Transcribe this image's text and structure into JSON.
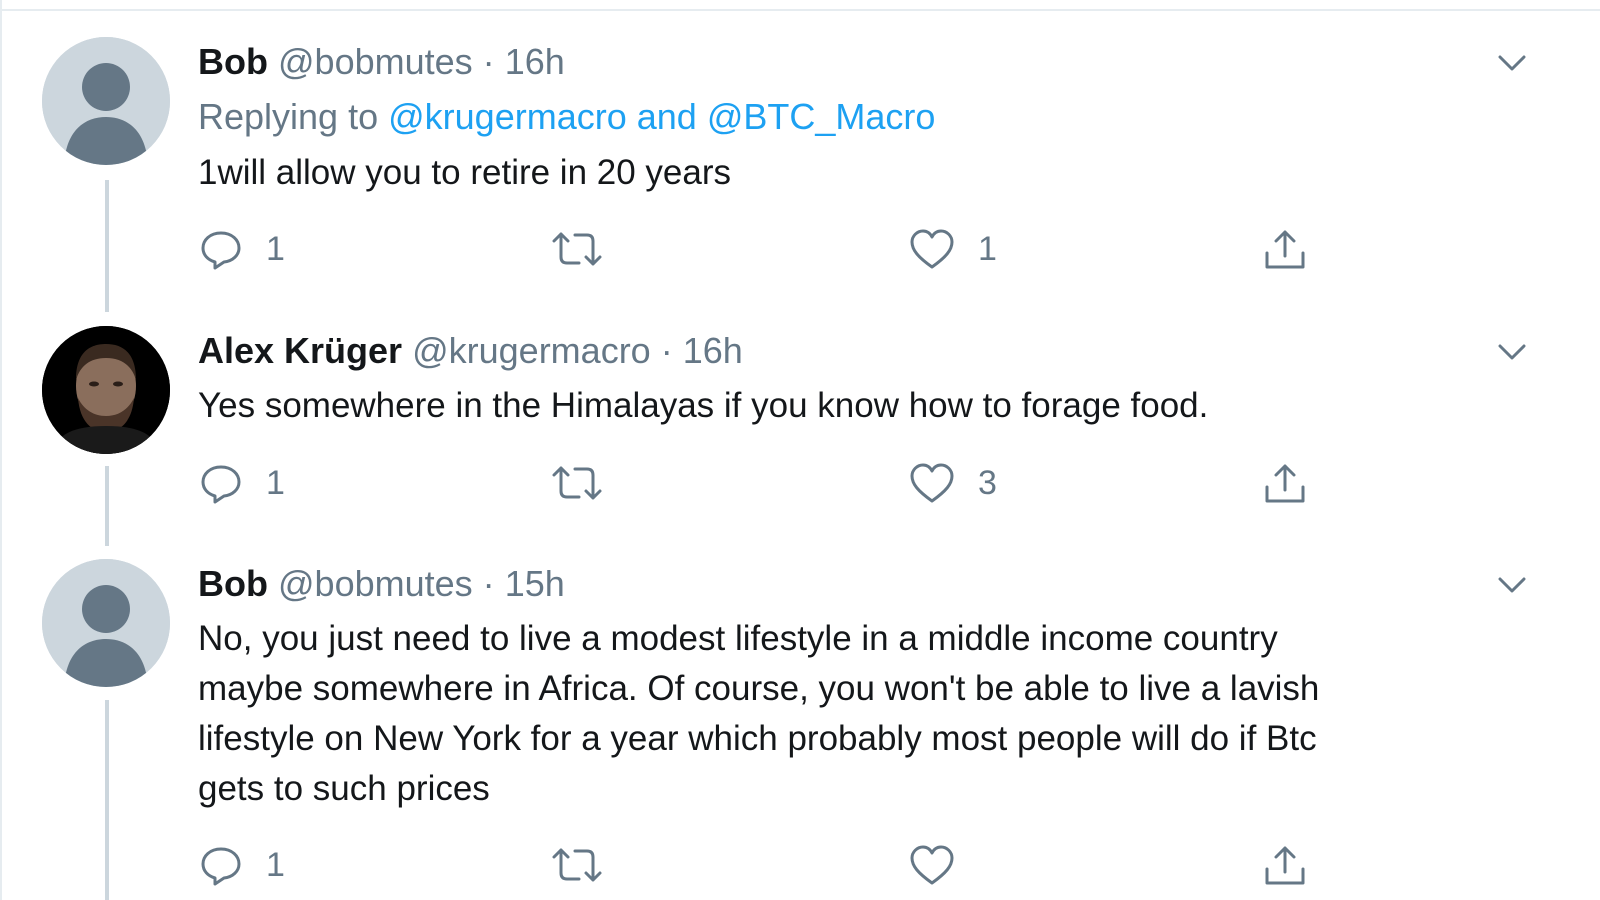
{
  "tweets": [
    {
      "name": "Bob",
      "handle": "@bobmutes",
      "time": "16h",
      "replying_prefix": "Replying to",
      "replying_to": "@krugermacro",
      "replying_conj": "and",
      "replying_to_2": "@BTC_Macro",
      "text": "1will allow you to retire in 20 years",
      "replies": "1",
      "retweets": "",
      "likes": "1",
      "avatar": "default-avatar"
    },
    {
      "name": "Alex Krüger",
      "handle": "@krugermacro",
      "time": "16h",
      "text": "Yes somewhere in the Himalayas if you know how to forage food.",
      "replies": "1",
      "retweets": "",
      "likes": "3",
      "avatar": "photo-avatar"
    },
    {
      "name": "Bob",
      "handle": "@bobmutes",
      "time": "15h",
      "text_lines": [
        "No, you just need to live a modest lifestyle in a middle income country",
        "maybe somewhere in Africa. Of course, you won't be able to live a lavish",
        "lifestyle on New York for a year which probably most people will do if Btc",
        "gets to such prices"
      ],
      "replies": "1",
      "retweets": "",
      "likes": "",
      "avatar": "default-avatar"
    }
  ],
  "separator": "·",
  "colors": {
    "text": "#14171a",
    "muted": "#657786",
    "link": "#1da1f2",
    "thread_line": "#ccd6dd",
    "divider": "#e6ecf0"
  }
}
